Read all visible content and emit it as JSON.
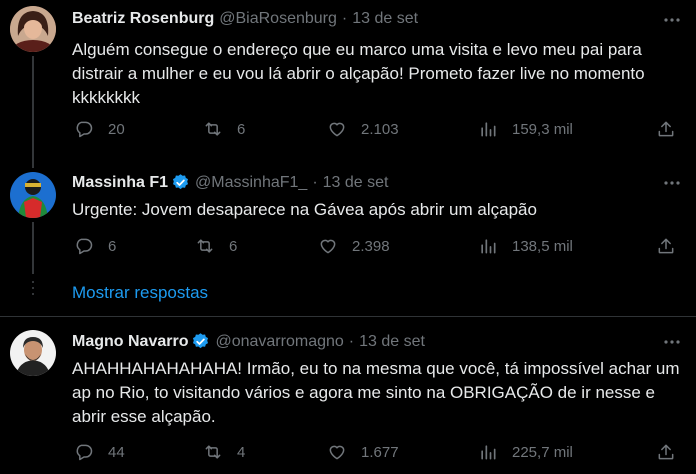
{
  "tweets": [
    {
      "name": "Beatriz Rosenburg",
      "handle": "@BiaRosenburg",
      "date": "13 de set",
      "verified": false,
      "text": "Alguém consegue o endereço que eu marco uma visita e levo meu pai para distrair a mulher e eu vou lá abrir o alçapão! Prometo fazer live no momento kkkkkkkk",
      "replies": "20",
      "retweets": "6",
      "likes": "2.103",
      "views": "159,3 mil"
    },
    {
      "name": "Massinha F1",
      "handle": "@MassinhaF1_",
      "date": "13 de set",
      "verified": true,
      "text": "Urgente: Jovem desaparece na Gávea após abrir um alçapão",
      "replies": "6",
      "retweets": "6",
      "likes": "2.398",
      "views": "138,5 mil"
    },
    {
      "name": "Magno Navarro",
      "handle": "@onavarromagno",
      "date": "13 de set",
      "verified": true,
      "text": "AHAHHAHAHAHAHA! Irmão, eu to na mesma que você, tá impossível achar um ap no Rio, to visitando vários e agora me sinto na OBRIGAÇÃO de ir nesse e abrir esse alçapão.",
      "replies": "44",
      "retweets": "4",
      "likes": "1.677",
      "views": "225,7 mil"
    }
  ],
  "show_replies": "Mostrar respostas",
  "dot": "·",
  "colors": {
    "background": "#000000",
    "text": "#e7e9ea",
    "muted": "#71767b",
    "accent": "#1d9bf0"
  }
}
